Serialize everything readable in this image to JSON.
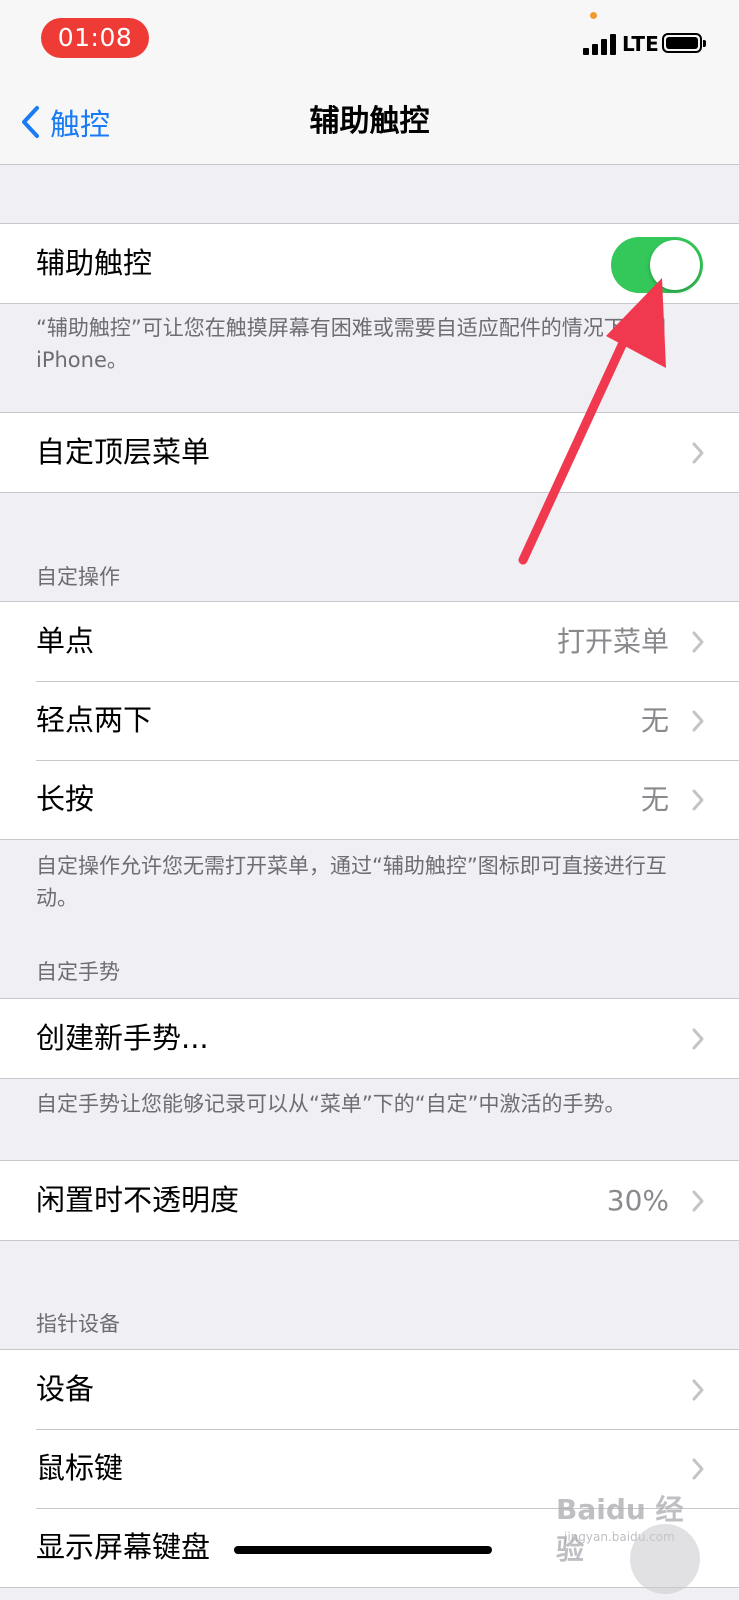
{
  "status_bar": {
    "time": "01:08",
    "network": "LTE"
  },
  "nav": {
    "back_label": "触控",
    "title": "辅助触控"
  },
  "assistive_touch": {
    "label": "辅助触控",
    "enabled": true,
    "footnote": "“辅助触控”可让您在触摸屏幕有困难或需要自适应配件的情况下使用iPhone。"
  },
  "top_menu": {
    "label": "自定顶层菜单"
  },
  "custom_actions": {
    "header": "自定操作",
    "rows": [
      {
        "label": "单点",
        "value": "打开菜单"
      },
      {
        "label": "轻点两下",
        "value": "无"
      },
      {
        "label": "长按",
        "value": "无"
      }
    ],
    "footnote": "自定操作允许您无需打开菜单，通过“辅助触控”图标即可直接进行互动。"
  },
  "custom_gestures": {
    "header": "自定手势",
    "create_label": "创建新手势...",
    "footnote": "自定手势让您能够记录可以从“菜单”下的“自定”中激活的手势。"
  },
  "idle_opacity": {
    "label": "闲置时不透明度",
    "value": "30%"
  },
  "pointer_devices": {
    "header": "指针设备",
    "rows": [
      {
        "label": "设备"
      },
      {
        "label": "鼠标键"
      },
      {
        "label": "显示屏幕键盘"
      }
    ]
  },
  "watermark": {
    "logo": "Baidu 经验",
    "url": "jingyan.baidu.com"
  },
  "colors": {
    "accent": "#1a7cf5",
    "toggle_on": "#34c759",
    "annotation_arrow": "#f0394f",
    "time_pill": "#ef3b36"
  }
}
